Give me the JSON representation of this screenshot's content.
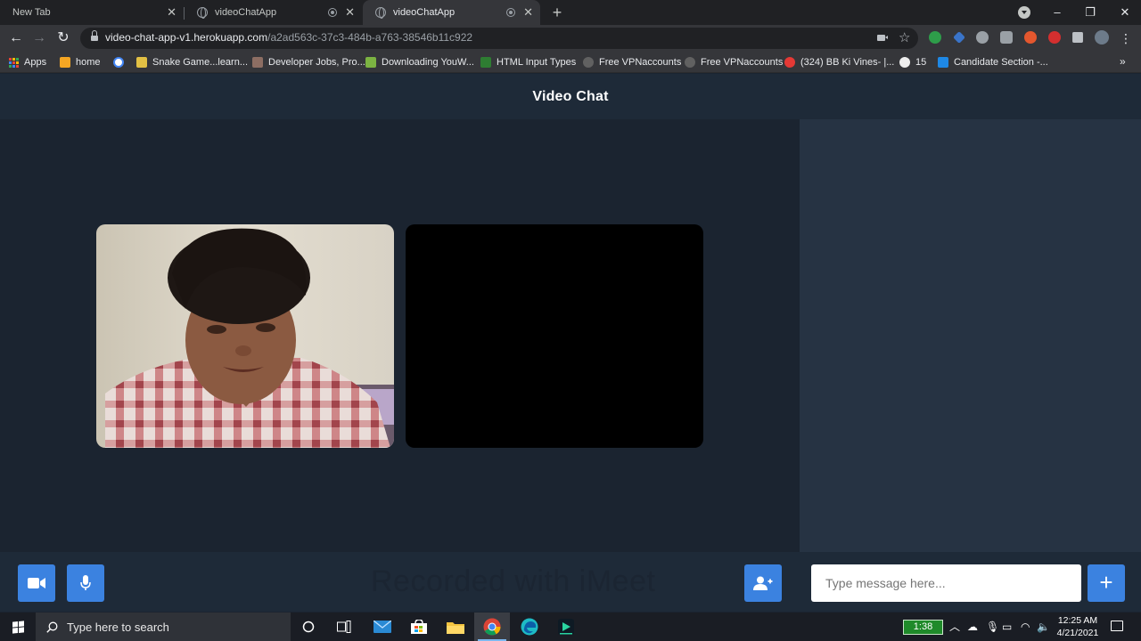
{
  "browser": {
    "tabs": [
      {
        "title": "New Tab",
        "active": false
      },
      {
        "title": "videoChatApp",
        "active": false
      },
      {
        "title": "videoChatApp",
        "active": true
      }
    ],
    "url_host": "video-chat-app-v1.herokuapp.com",
    "url_path": "/a2ad563c-37c3-484b-a763-38546b11c922"
  },
  "bookmarks": [
    {
      "label": "Apps",
      "color": "#4285f4"
    },
    {
      "label": "home",
      "color": "#f5a623"
    },
    {
      "label": "",
      "color": "#ffffff"
    },
    {
      "label": "Snake Game...learn...",
      "color": "#e2c044"
    },
    {
      "label": "Developer Jobs, Pro...",
      "color": "#8d6e63"
    },
    {
      "label": "Downloading YouW...",
      "color": "#7cb342"
    },
    {
      "label": "HTML Input Types",
      "color": "#2e7d32"
    },
    {
      "label": "Free VPNaccounts",
      "color": "#616161"
    },
    {
      "label": "Free VPNaccounts",
      "color": "#616161"
    },
    {
      "label": "(324) BB Ki Vines- |...",
      "color": "#e53935"
    },
    {
      "label": "15",
      "color": "#eeeeee"
    },
    {
      "label": "Candidate Section -...",
      "color": "#1e88e5"
    }
  ],
  "app": {
    "title": "Video Chat",
    "watermark": "Recorded with iMeet",
    "chat": {
      "placeholder": "Type message here...",
      "send_label": "+"
    },
    "controls": {
      "video_icon": "video-camera-icon",
      "mic_icon": "microphone-icon",
      "invite_icon": "add-user-icon"
    }
  },
  "taskbar": {
    "search_placeholder": "Type here to search",
    "clip_counter": "1:38",
    "time": "12:25 AM",
    "date": "4/21/2021"
  },
  "colors": {
    "accent": "#3b82e0",
    "page_bg": "#1b2430",
    "header_bg": "#1e2a38",
    "chat_panel_bg": "#263343"
  }
}
